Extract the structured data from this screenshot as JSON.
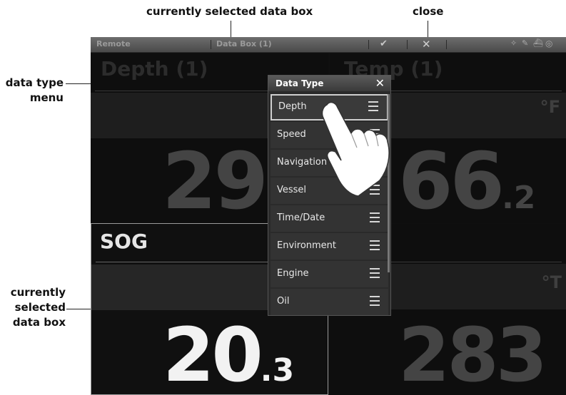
{
  "callouts": {
    "selected_box_top": "currently selected data box",
    "close": "close",
    "data_type_menu": [
      "data type",
      "menu"
    ],
    "selected_box_left": [
      "currently",
      "selected",
      "data box"
    ]
  },
  "titlebar": {
    "left": "Remote",
    "center": "Data Box (1)",
    "check_icon": "check-icon",
    "close_icon": "close-icon",
    "status_icons": [
      "satellite-icon",
      "pen-icon",
      "boat-icon",
      "compass-icon"
    ]
  },
  "panels": {
    "depth": {
      "title": "Depth (1)",
      "value_int": "29",
      "unit": ""
    },
    "temp": {
      "title": "Temp (1)",
      "unit": "°F",
      "value_int": "66",
      "value_dec": ".2"
    },
    "sog": {
      "title": "SOG",
      "value_int": "20",
      "value_dec": ".3"
    },
    "heading": {
      "unit": "°T",
      "value_int": "283"
    }
  },
  "menu": {
    "title": "Data Type",
    "items": [
      "Depth",
      "Speed",
      "Navigation",
      "Vessel",
      "Time/Date",
      "Environment",
      "Engine",
      "Oil"
    ],
    "selected": "Depth"
  },
  "colors": {
    "accent_selected_border": "#cfcfcf",
    "menu_bg": "#2a2a2a"
  }
}
